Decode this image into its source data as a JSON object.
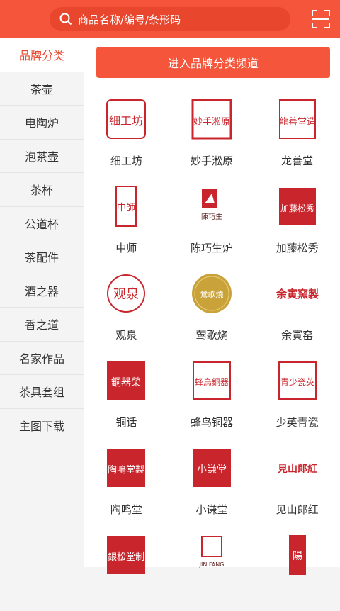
{
  "search": {
    "placeholder": "商品名称/编号/条形码"
  },
  "sidebar": {
    "items": [
      {
        "label": "品牌分类"
      },
      {
        "label": "茶壶"
      },
      {
        "label": "电陶炉"
      },
      {
        "label": "泡茶壶"
      },
      {
        "label": "茶杯"
      },
      {
        "label": "公道杯"
      },
      {
        "label": "茶配件"
      },
      {
        "label": "酒之器"
      },
      {
        "label": "香之道"
      },
      {
        "label": "名家作品"
      },
      {
        "label": "茶具套组"
      },
      {
        "label": "主图下载"
      }
    ]
  },
  "channel_button": {
    "label": "进入品牌分类频道"
  },
  "brands": [
    {
      "name": "细工坊",
      "logo_text": "細工坊"
    },
    {
      "name": "妙手淞原",
      "logo_text": "妙手淞原"
    },
    {
      "name": "龙善堂",
      "logo_text": "龍善堂造"
    },
    {
      "name": "中师",
      "logo_text": "中師"
    },
    {
      "name": "陈巧生炉",
      "logo_text": "陳巧生"
    },
    {
      "name": "加藤松秀",
      "logo_text": "加藤松秀"
    },
    {
      "name": "观泉",
      "logo_text": "观泉"
    },
    {
      "name": "莺歌烧",
      "logo_text": "鶯歌燒"
    },
    {
      "name": "余寅窑",
      "logo_text": "余寅窯製"
    },
    {
      "name": "铜话",
      "logo_text": "銅器榮"
    },
    {
      "name": "蜂鸟铜器",
      "logo_text": "蜂鳥銅器"
    },
    {
      "name": "少英青瓷",
      "logo_text": "青少瓷英"
    },
    {
      "name": "陶鸣堂",
      "logo_text": "陶鳴堂製"
    },
    {
      "name": "小谦堂",
      "logo_text": "小謙堂"
    },
    {
      "name": "见山郎红",
      "logo_text": "見山郎紅"
    },
    {
      "name": "",
      "logo_text": "銀松堂制"
    },
    {
      "name": "",
      "logo_text": "JIN FANG"
    },
    {
      "name": "",
      "logo_text": "陽"
    }
  ],
  "colors": {
    "accent": "#f4553b",
    "seal": "#c8262c",
    "gold": "#c9a33a"
  }
}
